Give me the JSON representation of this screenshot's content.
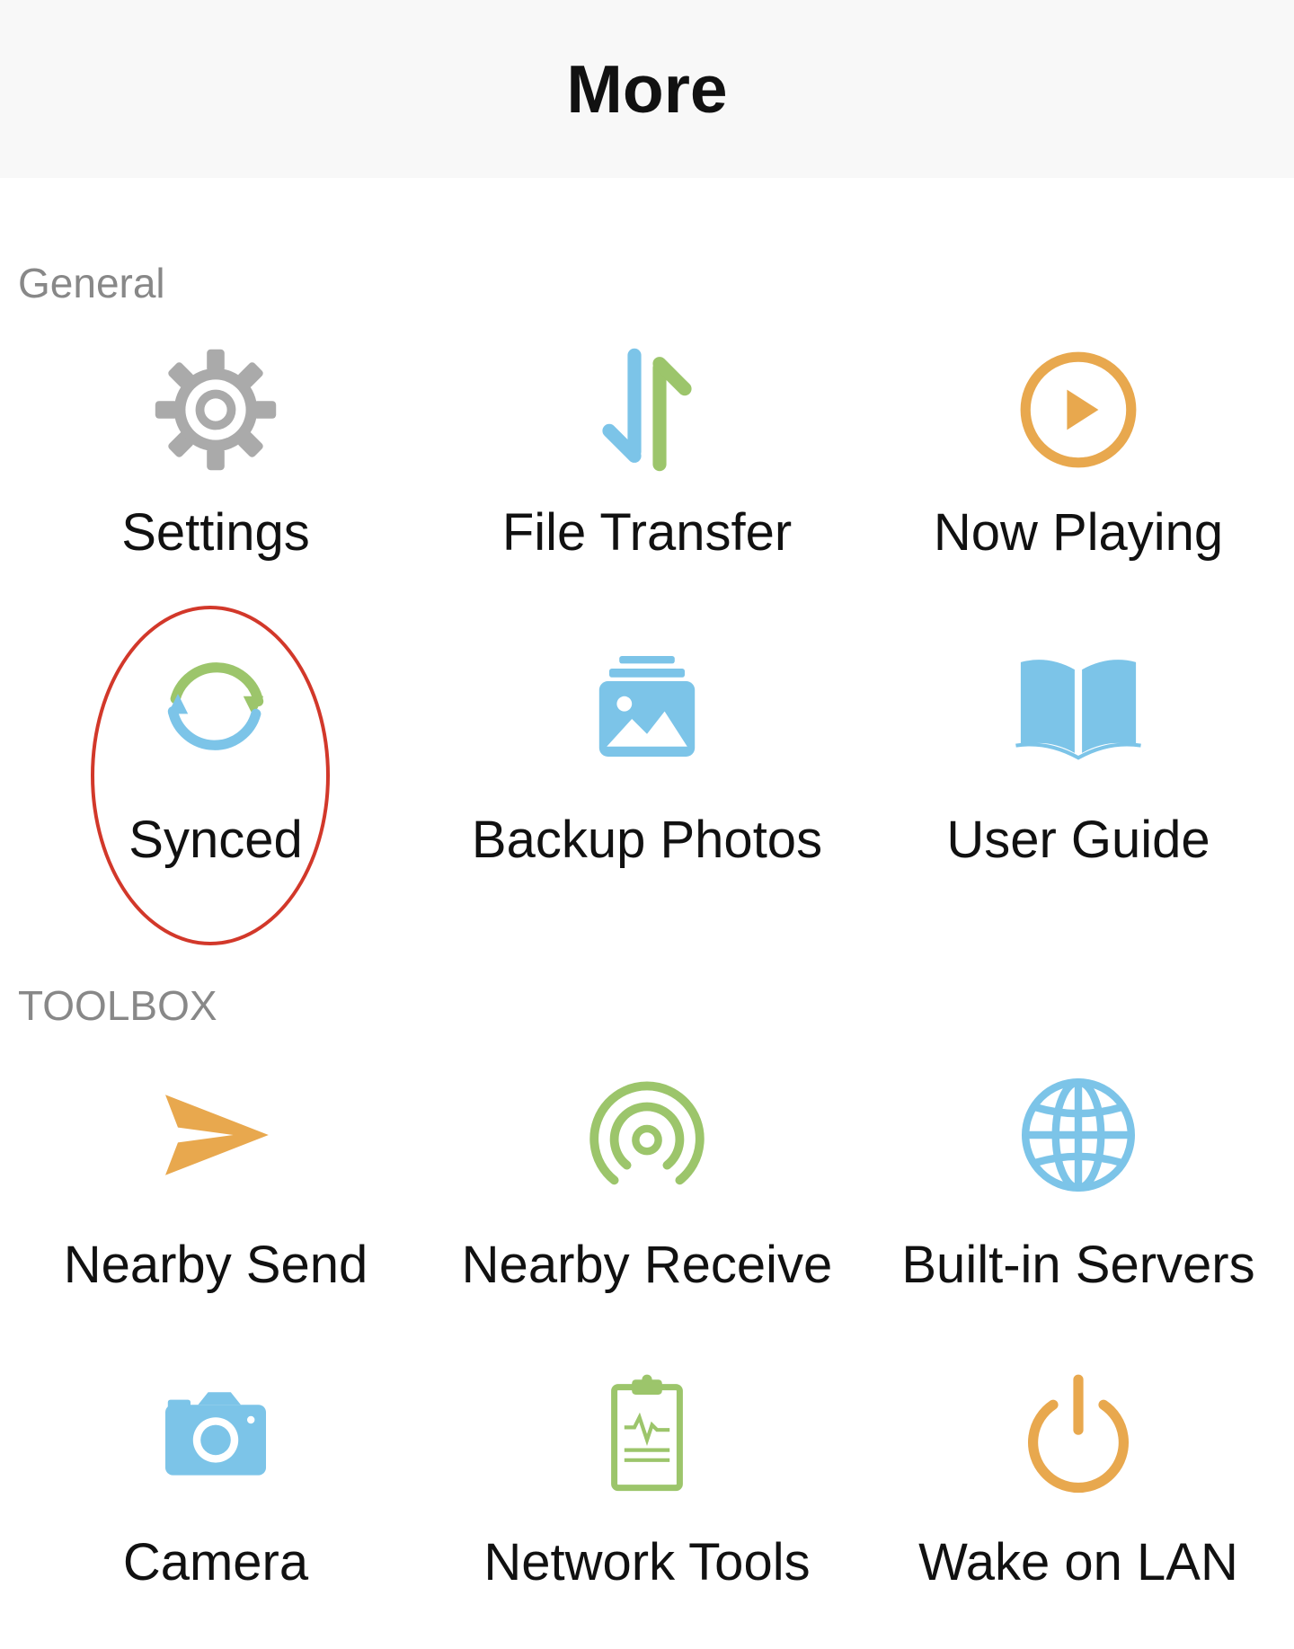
{
  "header": {
    "title": "More"
  },
  "sections": {
    "general": {
      "label": "General",
      "items": [
        {
          "label": "Settings",
          "icon": "gear-icon"
        },
        {
          "label": "File Transfer",
          "icon": "transfer-arrows-icon"
        },
        {
          "label": "Now Playing",
          "icon": "play-circle-icon"
        },
        {
          "label": "Synced",
          "icon": "sync-icon"
        },
        {
          "label": "Backup Photos",
          "icon": "photos-icon"
        },
        {
          "label": "User Guide",
          "icon": "book-icon"
        }
      ]
    },
    "toolbox": {
      "label": "TOOLBOX",
      "items": [
        {
          "label": "Nearby Send",
          "icon": "paper-plane-icon"
        },
        {
          "label": "Nearby Receive",
          "icon": "broadcast-icon"
        },
        {
          "label": "Built-in Servers",
          "icon": "globe-icon"
        },
        {
          "label": "Camera",
          "icon": "camera-icon"
        },
        {
          "label": "Network Tools",
          "icon": "clipboard-pulse-icon"
        },
        {
          "label": "Wake on LAN",
          "icon": "power-icon"
        }
      ]
    }
  },
  "colors": {
    "gray": "#aaaaaa",
    "blue": "#7cc4e8",
    "green": "#9cc56b",
    "orange": "#e8a84e",
    "highlight": "#d2382a"
  }
}
